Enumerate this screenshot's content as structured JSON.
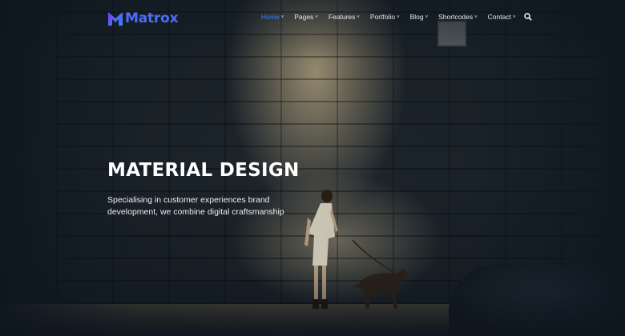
{
  "brand": {
    "name": "Matrox"
  },
  "nav": {
    "items": [
      {
        "label": "Home",
        "active": true,
        "has_dropdown": true
      },
      {
        "label": "Pages",
        "active": false,
        "has_dropdown": true
      },
      {
        "label": "Features",
        "active": false,
        "has_dropdown": true
      },
      {
        "label": "Portfolio",
        "active": false,
        "has_dropdown": true
      },
      {
        "label": "Blog",
        "active": false,
        "has_dropdown": true
      },
      {
        "label": "Shortcodes",
        "active": false,
        "has_dropdown": true
      },
      {
        "label": "Contact",
        "active": false,
        "has_dropdown": true
      }
    ],
    "chevron": "˅",
    "search_icon": "magnifier-icon"
  },
  "hero": {
    "headline": "MATERIAL DESIGN",
    "subtext": "Specialising in customer experiences brand development, we combine digital craftsmanship"
  },
  "colors": {
    "accent": "#3d7cf0",
    "logo_gradient_start": "#7b3cf0",
    "logo_gradient_end": "#2f8cf5",
    "background": "#0e1620"
  }
}
